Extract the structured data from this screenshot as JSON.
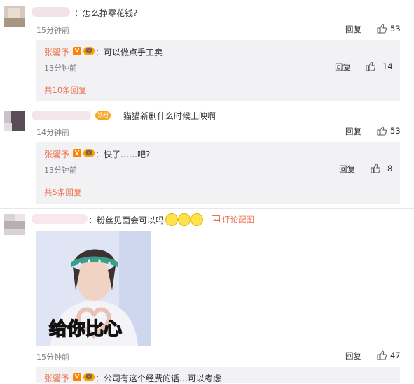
{
  "colors": {
    "author": "#eb7350",
    "reply_bg": "#f2f2f5",
    "muted": "#808080"
  },
  "comments": [
    {
      "text": "：怎么挣零花钱?",
      "time": "15分钟前",
      "reply_label": "回复",
      "likes": "53",
      "reply": {
        "author": "张馨予",
        "verified": "V",
        "text": "：可以做点手工卖",
        "time": "13分钟前",
        "reply_label": "回复",
        "likes": "14"
      },
      "more_replies": "共10条回复"
    },
    {
      "fan_badge": "铁粉",
      "text": "猫猫新剧什么时候上映啊",
      "time": "14分钟前",
      "reply_label": "回复",
      "likes": "53",
      "reply": {
        "author": "张馨予",
        "verified": "V",
        "text": "：快了……吧?",
        "time": "13分钟前",
        "reply_label": "回复",
        "likes": "8"
      },
      "more_replies": "共5条回复"
    },
    {
      "text": "：粉丝见面会可以吗",
      "emojis": [
        "smile-emoji",
        "smile-emoji",
        "smile-emoji"
      ],
      "image_link": "评论配图",
      "image_caption": "给你比心",
      "time": "15分钟前",
      "reply_label": "回复",
      "likes": "47",
      "reply": {
        "author": "张馨予",
        "verified": "V",
        "text": "：公司有这个经费的话…可以考虑"
      }
    }
  ]
}
